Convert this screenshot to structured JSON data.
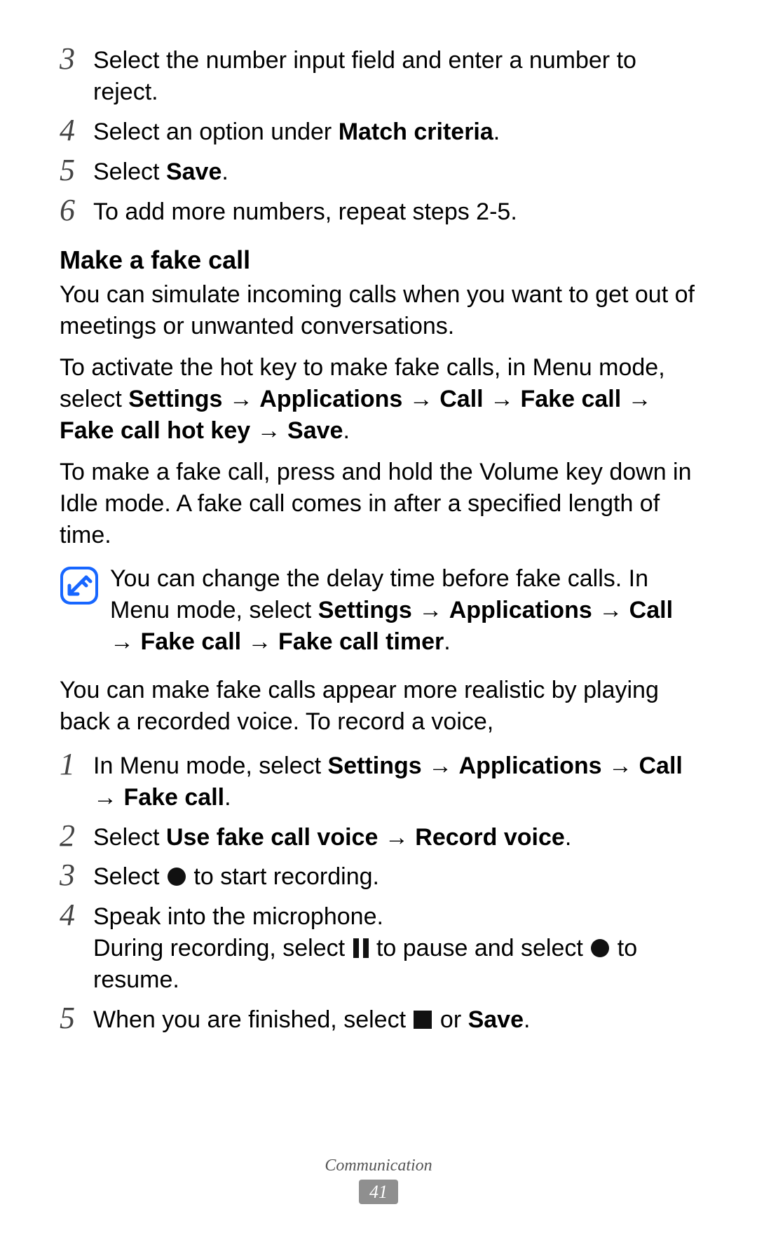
{
  "topSteps": [
    {
      "num": "3",
      "segments": [
        {
          "t": "Select the number input field and enter a number to reject."
        }
      ]
    },
    {
      "num": "4",
      "segments": [
        {
          "t": "Select an option under "
        },
        {
          "t": "Match criteria",
          "b": true
        },
        {
          "t": "."
        }
      ]
    },
    {
      "num": "5",
      "segments": [
        {
          "t": "Select "
        },
        {
          "t": "Save",
          "b": true
        },
        {
          "t": "."
        }
      ]
    },
    {
      "num": "6",
      "segments": [
        {
          "t": "To add more numbers, repeat steps 2-5."
        }
      ]
    }
  ],
  "sectionTitle": "Make a fake call",
  "para1": [
    {
      "t": "You can simulate incoming calls when you want to get out of meetings or unwanted conversations."
    }
  ],
  "para2": [
    {
      "t": "To activate the hot key to make fake calls, in Menu mode, select "
    },
    {
      "t": "Settings",
      "b": true
    },
    {
      "arrow": true
    },
    {
      "t": "Applications",
      "b": true
    },
    {
      "arrow": true
    },
    {
      "t": "Call",
      "b": true
    },
    {
      "arrow": true
    },
    {
      "t": "Fake call",
      "b": true
    },
    {
      "arrow": true
    },
    {
      "t": "Fake call hot key",
      "b": true
    },
    {
      "arrow": true
    },
    {
      "t": "Save",
      "b": true
    },
    {
      "t": "."
    }
  ],
  "para3": [
    {
      "t": "To make a fake call, press and hold the Volume key down in Idle mode. A fake call comes in after a specified length of time."
    }
  ],
  "note": [
    {
      "t": "You can change the delay time before fake calls. In Menu mode, select "
    },
    {
      "t": "Settings",
      "b": true
    },
    {
      "arrow": true
    },
    {
      "t": "Applications",
      "b": true
    },
    {
      "arrow": true
    },
    {
      "t": "Call",
      "b": true
    },
    {
      "arrow": true
    },
    {
      "t": "Fake call",
      "b": true
    },
    {
      "arrow": true
    },
    {
      "t": "Fake call timer",
      "b": true
    },
    {
      "t": "."
    }
  ],
  "para4": [
    {
      "t": "You can make fake calls appear more realistic by playing back a recorded voice. To record a voice,"
    }
  ],
  "bottomSteps": [
    {
      "num": "1",
      "segments": [
        {
          "t": "In Menu mode, select "
        },
        {
          "t": "Settings",
          "b": true
        },
        {
          "arrow": true
        },
        {
          "t": "Applications",
          "b": true
        },
        {
          "arrow": true
        },
        {
          "t": "Call",
          "b": true
        },
        {
          "arrow": true
        },
        {
          "t": "Fake call",
          "b": true
        },
        {
          "t": "."
        }
      ]
    },
    {
      "num": "2",
      "segments": [
        {
          "t": "Select "
        },
        {
          "t": "Use fake call voice",
          "b": true
        },
        {
          "arrow": true
        },
        {
          "t": "Record voice",
          "b": true
        },
        {
          "t": "."
        }
      ]
    },
    {
      "num": "3",
      "segments": [
        {
          "t": "Select "
        },
        {
          "icon": "record"
        },
        {
          "t": " to start recording."
        }
      ]
    },
    {
      "num": "4",
      "segments": [
        {
          "t": "Speak into the microphone."
        },
        {
          "br": true
        },
        {
          "t": "During recording, select "
        },
        {
          "icon": "pause"
        },
        {
          "t": " to pause and select "
        },
        {
          "icon": "record"
        },
        {
          "t": " to resume."
        }
      ]
    },
    {
      "num": "5",
      "segments": [
        {
          "t": "When you are finished, select "
        },
        {
          "icon": "stop"
        },
        {
          "t": " or "
        },
        {
          "t": "Save",
          "b": true
        },
        {
          "t": "."
        }
      ]
    }
  ],
  "arrowGlyph": " → ",
  "footerSection": "Communication",
  "pageNumber": "41"
}
